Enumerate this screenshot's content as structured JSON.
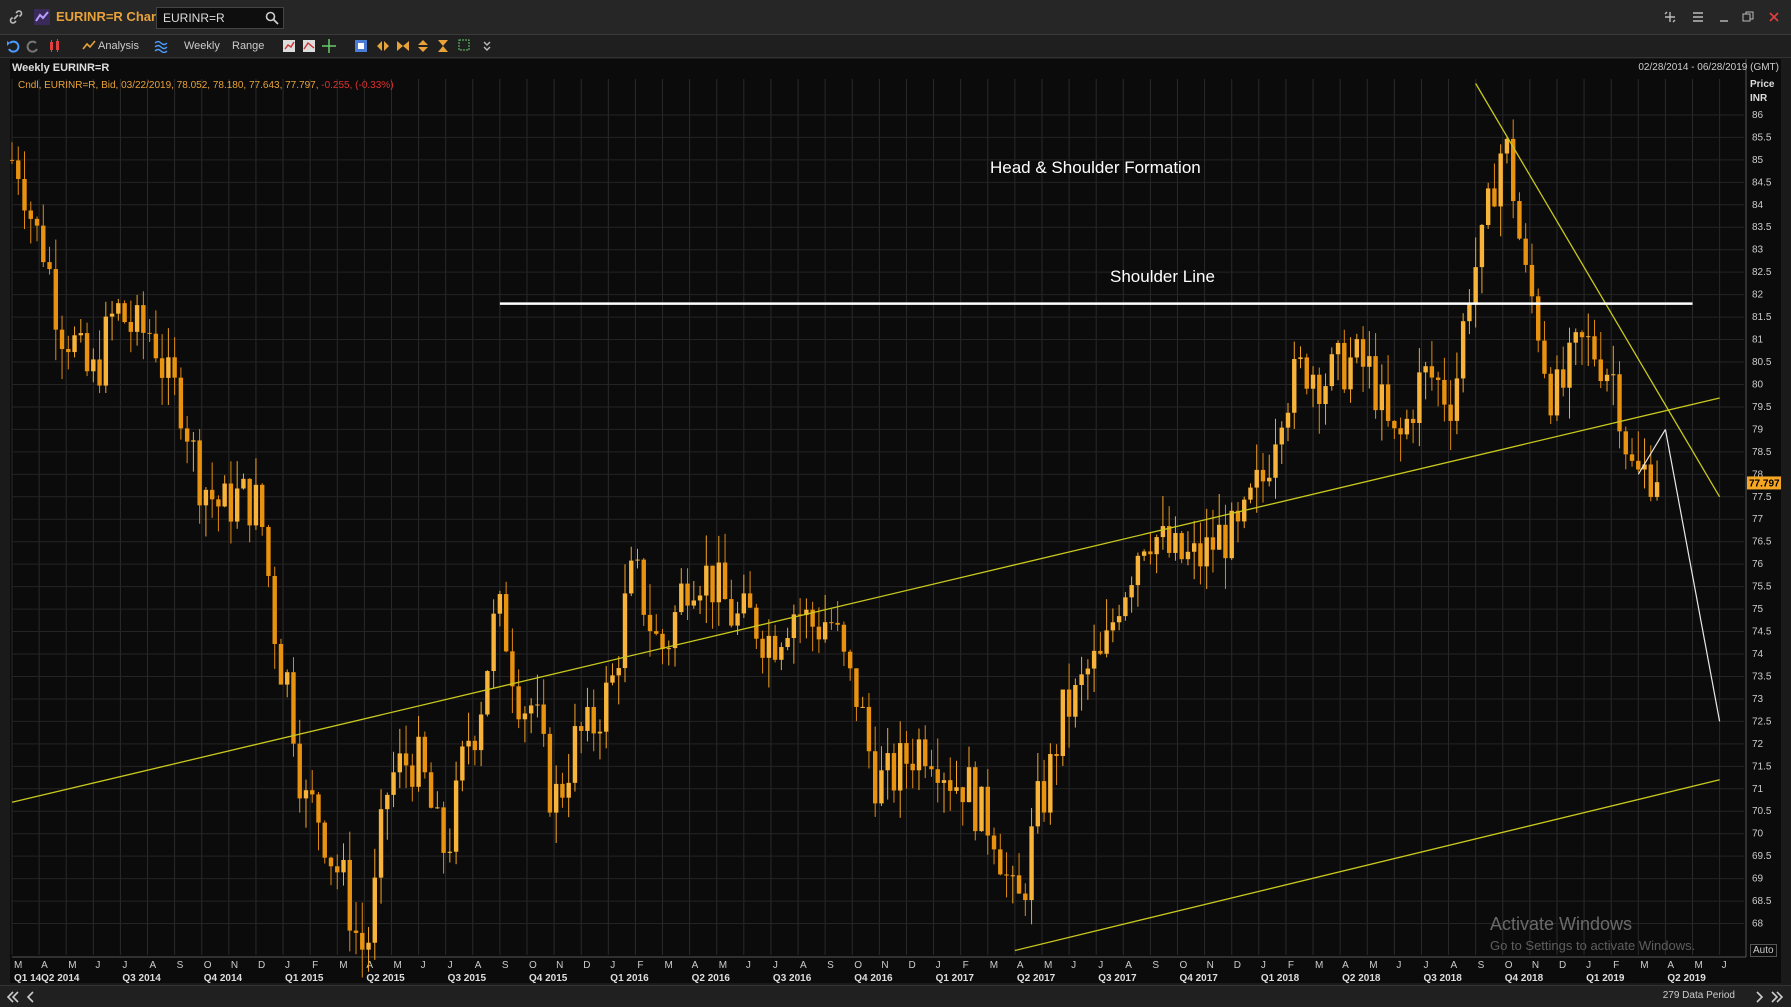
{
  "app": {
    "title": "EURINR=R Chart",
    "search_value": "EURINR=R"
  },
  "toolbar": {
    "analysis_label": "Analysis",
    "interval_label": "Weekly",
    "range_label": "Range"
  },
  "chart_info": {
    "title": "Weekly EURINR=R",
    "date_range": "02/28/2014 - 06/28/2019 (GMT)",
    "quote_line": "Cndl, EURINR=R, Bid, 03/22/2019, 78.052, 78.180, 77.643, 77.797,",
    "quote_change": "-0.255, (-0.33%)",
    "price_label": "Price",
    "currency_label": "INR",
    "last_price": "77.797"
  },
  "annotations": {
    "formation": "Head & Shoulder Formation",
    "shoulder": "Shoulder Line"
  },
  "status": {
    "data_period": "279 Data Period",
    "auto_label": "Auto"
  },
  "watermark": {
    "line1": "Activate Windows",
    "line2": "Go to Settings to activate Windows."
  },
  "colors": {
    "candle": "#f5a623",
    "trendline": "#c8c81e",
    "background": "#0b0b0b",
    "last_price_badge": "#f5a623",
    "change_negative": "#e03030"
  },
  "icons": [
    "link-icon",
    "chart-icon",
    "search-icon",
    "undo-icon",
    "redo-icon",
    "candle-type-icon",
    "analysis-icon",
    "interval-icon",
    "settings-icon",
    "minimize-icon",
    "restore-icon",
    "close-icon"
  ],
  "chart_data": {
    "type": "candlestick",
    "title": "Weekly EURINR=R",
    "ylabel": "Price INR",
    "ylim": [
      67.3,
      86.8
    ],
    "y_ticks": [
      "86",
      "85.5",
      "85",
      "84.5",
      "84",
      "83.5",
      "83",
      "82.5",
      "82",
      "81.5",
      "81",
      "80.5",
      "80",
      "79.5",
      "79",
      "78.5",
      "78",
      "77.5",
      "77",
      "76.5",
      "76",
      "75.5",
      "75",
      "74.5",
      "74",
      "73.5",
      "73",
      "72.5",
      "72",
      "71.5",
      "71",
      "70.5",
      "70",
      "69.5",
      "69",
      "68.5",
      "68"
    ],
    "x_ticks_months": [
      "M",
      "A",
      "M",
      "J",
      "J",
      "A",
      "S",
      "O",
      "N",
      "D",
      "J",
      "F",
      "M",
      "A",
      "M",
      "J",
      "J",
      "A",
      "S",
      "O",
      "N",
      "D",
      "J",
      "F",
      "M",
      "A",
      "M",
      "J",
      "J",
      "A",
      "S",
      "O",
      "N",
      "D",
      "J",
      "F",
      "M",
      "A",
      "M",
      "J",
      "J",
      "A",
      "S",
      "O",
      "N",
      "D",
      "J",
      "F",
      "M",
      "A",
      "M",
      "J",
      "J",
      "A",
      "S",
      "O",
      "N",
      "D",
      "J",
      "F",
      "M",
      "A",
      "M",
      "J"
    ],
    "x_ticks_quarters": [
      "Q1 14",
      "Q2 2014",
      "Q3 2014",
      "Q4 2014",
      "Q1 2015",
      "Q2 2015",
      "Q3 2015",
      "Q4 2015",
      "Q1 2016",
      "Q2 2016",
      "Q3 2016",
      "Q4 2016",
      "Q1 2017",
      "Q2 2017",
      "Q3 2017",
      "Q4 2017",
      "Q1 2018",
      "Q2 2018",
      "Q3 2018",
      "Q4 2018",
      "Q1 2019",
      "Q2 2019"
    ],
    "path_anchors": [
      {
        "x": "2014-03",
        "y": 85.0
      },
      {
        "x": "2014-04",
        "y": 83.0
      },
      {
        "x": "2014-05",
        "y": 81.5
      },
      {
        "x": "2014-06",
        "y": 80.0
      },
      {
        "x": "2014-07",
        "y": 81.5
      },
      {
        "x": "2014-08",
        "y": 81.5
      },
      {
        "x": "2014-09",
        "y": 79.5
      },
      {
        "x": "2014-10",
        "y": 78.0
      },
      {
        "x": "2014-11",
        "y": 77.5
      },
      {
        "x": "2014-12",
        "y": 77.0
      },
      {
        "x": "2015-01",
        "y": 74.0
      },
      {
        "x": "2015-02",
        "y": 70.5
      },
      {
        "x": "2015-03",
        "y": 69.0
      },
      {
        "x": "2015-04",
        "y": 67.8
      },
      {
        "x": "2015-05",
        "y": 71.0
      },
      {
        "x": "2015-06",
        "y": 71.5
      },
      {
        "x": "2015-07",
        "y": 70.0
      },
      {
        "x": "2015-08",
        "y": 72.0
      },
      {
        "x": "2015-09",
        "y": 75.0
      },
      {
        "x": "2015-10",
        "y": 73.0
      },
      {
        "x": "2015-11",
        "y": 70.5
      },
      {
        "x": "2015-12",
        "y": 72.5
      },
      {
        "x": "2016-01",
        "y": 73.0
      },
      {
        "x": "2016-02",
        "y": 75.5
      },
      {
        "x": "2016-03",
        "y": 74.5
      },
      {
        "x": "2016-04",
        "y": 75.5
      },
      {
        "x": "2016-05",
        "y": 75.5
      },
      {
        "x": "2016-06",
        "y": 75.0
      },
      {
        "x": "2016-07",
        "y": 74.0
      },
      {
        "x": "2016-08",
        "y": 75.2
      },
      {
        "x": "2016-09",
        "y": 74.8
      },
      {
        "x": "2016-10",
        "y": 73.0
      },
      {
        "x": "2016-11",
        "y": 71.5
      },
      {
        "x": "2016-12",
        "y": 71.5
      },
      {
        "x": "2017-01",
        "y": 71.8
      },
      {
        "x": "2017-02",
        "y": 71.5
      },
      {
        "x": "2017-03",
        "y": 70.0
      },
      {
        "x": "2017-04",
        "y": 68.5
      },
      {
        "x": "2017-05",
        "y": 71.0
      },
      {
        "x": "2017-06",
        "y": 72.5
      },
      {
        "x": "2017-07",
        "y": 74.0
      },
      {
        "x": "2017-08",
        "y": 75.5
      },
      {
        "x": "2017-09",
        "y": 76.5
      },
      {
        "x": "2017-10",
        "y": 76.5
      },
      {
        "x": "2017-11",
        "y": 76.0
      },
      {
        "x": "2017-12",
        "y": 76.5
      },
      {
        "x": "2018-01",
        "y": 78.0
      },
      {
        "x": "2018-02",
        "y": 79.5
      },
      {
        "x": "2018-03",
        "y": 80.5
      },
      {
        "x": "2018-04",
        "y": 80.5
      },
      {
        "x": "2018-05",
        "y": 80.0
      },
      {
        "x": "2018-06",
        "y": 79.0
      },
      {
        "x": "2018-07",
        "y": 80.0
      },
      {
        "x": "2018-08",
        "y": 79.5
      },
      {
        "x": "2018-09",
        "y": 83.0
      },
      {
        "x": "2018-10",
        "y": 85.0
      },
      {
        "x": "2018-11",
        "y": 82.0
      },
      {
        "x": "2018-12",
        "y": 80.0
      },
      {
        "x": "2019-01",
        "y": 80.5
      },
      {
        "x": "2019-02",
        "y": 80.5
      },
      {
        "x": "2019-03",
        "y": 78.0
      },
      {
        "x": "2019-03-22",
        "y": 77.797
      }
    ],
    "last_price": 77.797,
    "trendlines": [
      {
        "name": "lower trend support",
        "points": [
          {
            "x": "2014-03",
            "y": 70.7
          },
          {
            "x": "2019-06",
            "y": 79.7
          }
        ]
      },
      {
        "name": "upper channel descending",
        "points": [
          {
            "x": "2018-09",
            "y": 86.7
          },
          {
            "x": "2019-06",
            "y": 77.5
          }
        ]
      },
      {
        "name": "lower channel",
        "points": [
          {
            "x": "2017-04",
            "y": 67.4
          },
          {
            "x": "2019-06",
            "y": 71.2
          }
        ]
      }
    ],
    "horizontal_lines": [
      {
        "name": "shoulder line",
        "y": 81.8,
        "from": "2015-09",
        "to": "2019-05"
      }
    ],
    "projection_arrows": [
      {
        "from": {
          "x": "2019-03",
          "y": 78.0
        },
        "to": {
          "x": "2019-04",
          "y": 79.0
        }
      },
      {
        "from": {
          "x": "2019-04",
          "y": 79.0
        },
        "to": {
          "x": "2019-06",
          "y": 72.5
        }
      }
    ]
  }
}
